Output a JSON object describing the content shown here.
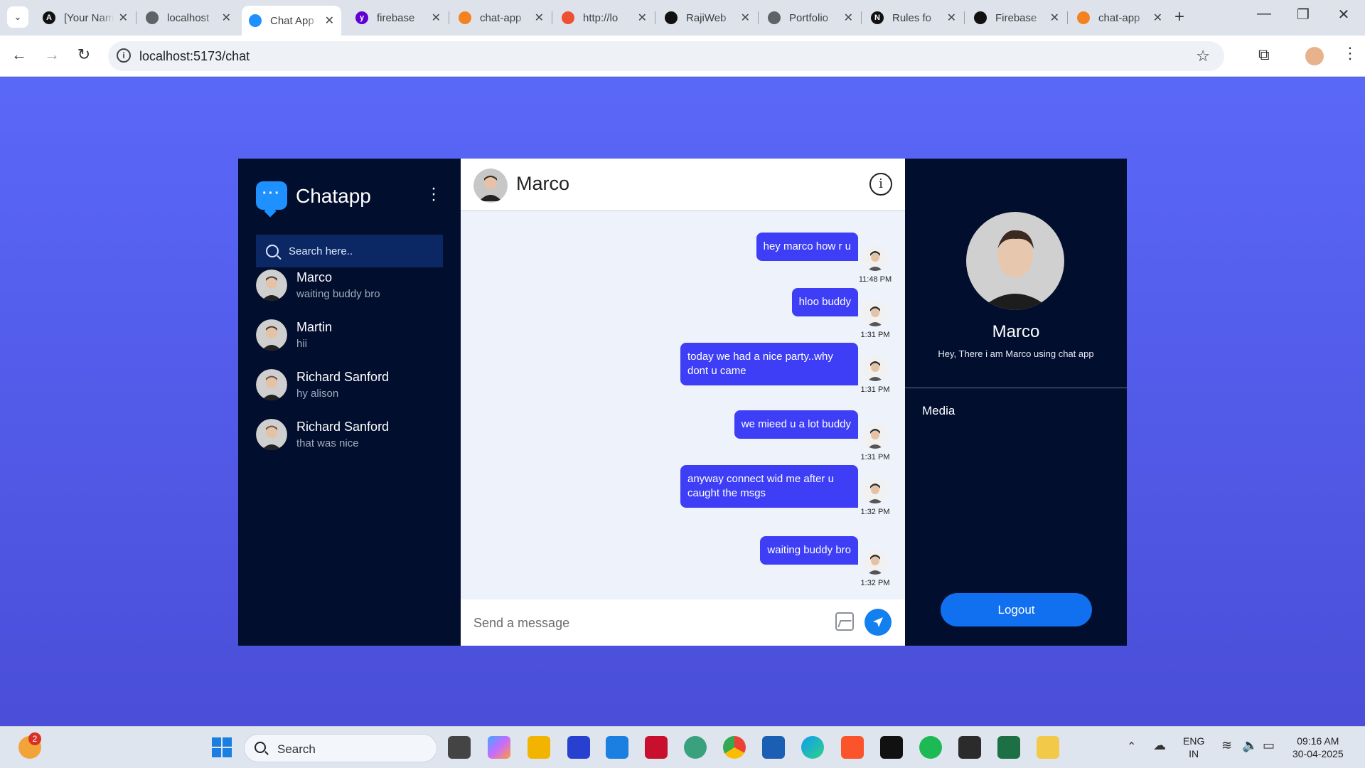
{
  "browser": {
    "tabs": [
      {
        "title": "[Your Name]",
        "fav": "A",
        "fav_color": "#111111"
      },
      {
        "title": "localhost",
        "fav": "",
        "fav_color": "#5f6368"
      },
      {
        "title": "Chat App",
        "fav": "",
        "fav_color": "#1e90ff"
      },
      {
        "title": "firebase",
        "fav": "y",
        "fav_color": "#6001d2"
      },
      {
        "title": "chat-app",
        "fav": "",
        "fav_color": "#f58220"
      },
      {
        "title": "http://lo",
        "fav": "",
        "fav_color": "#f05032"
      },
      {
        "title": "RajiWeb",
        "fav": "",
        "fav_color": "#111111"
      },
      {
        "title": "Portfolio",
        "fav": "",
        "fav_color": "#5f6368"
      },
      {
        "title": "Rules fo",
        "fav": "N",
        "fav_color": "#111111"
      },
      {
        "title": "Firebase",
        "fav": "",
        "fav_color": "#111111"
      },
      {
        "title": "chat-app",
        "fav": "",
        "fav_color": "#f58220"
      }
    ],
    "url": "localhost:5173/chat"
  },
  "app": {
    "brand": "Chatapp",
    "search_placeholder": "Search here..",
    "contacts": [
      {
        "name": "Marco",
        "last": "waiting buddy bro",
        "avatar_color": "#3a3a3a"
      },
      {
        "name": "Martin",
        "last": "hii",
        "avatar_color": "#4a3b30"
      },
      {
        "name": "Richard Sanford",
        "last": "hy alison",
        "avatar_color": "#6b5446"
      },
      {
        "name": "Richard Sanford",
        "last": "that was nice",
        "avatar_color": "#6b5446"
      }
    ],
    "chat": {
      "name": "Marco",
      "messages": [
        {
          "text": "hey marco how r u",
          "time": "11:48 PM"
        },
        {
          "text": "hloo buddy",
          "time": "1:31 PM"
        },
        {
          "text": "today we had a nice party..why dont u came",
          "time": "1:31 PM"
        },
        {
          "text": "we mieed u a lot buddy",
          "time": "1:31 PM"
        },
        {
          "text": "anyway connect wid me after u caught the msgs",
          "time": "1:32 PM"
        },
        {
          "text": "waiting buddy bro",
          "time": "1:32 PM"
        }
      ],
      "input_placeholder": "Send a message"
    },
    "profile": {
      "name": "Marco",
      "bio": "Hey, There i am Marco using chat app",
      "media_label": "Media",
      "logout_label": "Logout"
    }
  },
  "taskbar": {
    "search_label": "Search",
    "notification_count": "2",
    "lang_line1": "ENG",
    "lang_line2": "IN",
    "time": "09:16 AM",
    "date": "30-04-2025"
  }
}
